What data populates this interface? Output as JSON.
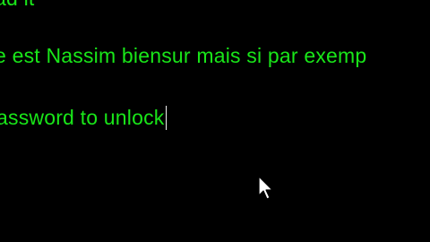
{
  "terminal": {
    "lines": [
      "ad it",
      "e est Nassim biensur mais si par exemp",
      "assword to unlock"
    ],
    "text_color": "#19e619",
    "background_color": "#000000"
  },
  "cursor": {
    "icon": "mouse-pointer-arrow-icon"
  },
  "caret": {
    "icon": "text-caret-icon"
  }
}
